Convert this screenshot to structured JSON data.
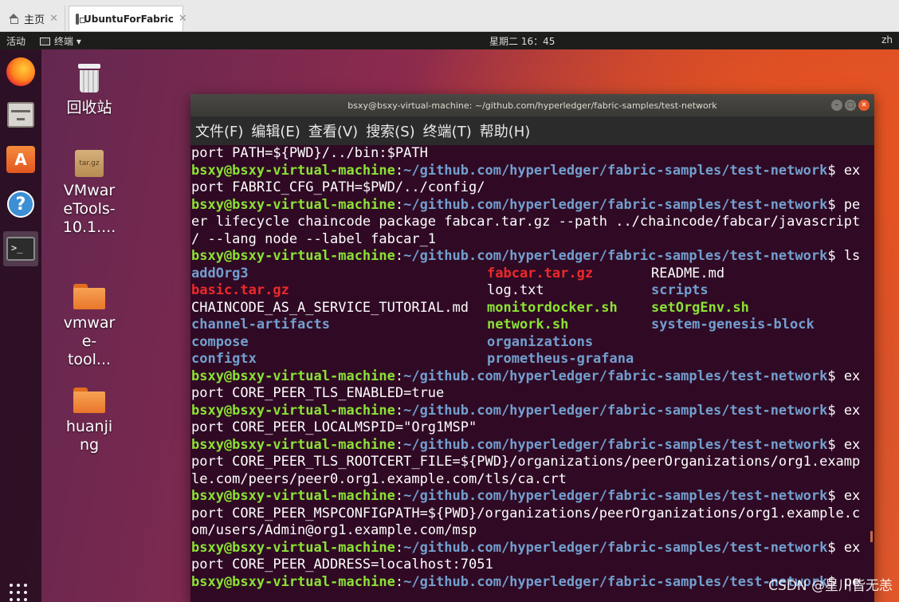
{
  "vm_tabs": [
    {
      "label": "主页",
      "icon": "home-icon"
    },
    {
      "label": "UbuntuForFabric",
      "icon": "vm-icon"
    }
  ],
  "topbar": {
    "activities": "活动",
    "app_menu": "终端 ▾",
    "clock": "星期二 16：45",
    "lang": "zh"
  },
  "desktop_icons": [
    {
      "label": "回收站",
      "icon": "trash-icon"
    },
    {
      "label_lines": [
        "VMwar",
        "eTools-",
        "10.1...."
      ],
      "icon": "archive-icon",
      "badge": "tar.gz"
    },
    {
      "label_lines": [
        "vmwar",
        "e-",
        "tool..."
      ],
      "icon": "folder-icon"
    },
    {
      "label_lines": [
        "huanji",
        "ng"
      ],
      "icon": "folder-icon"
    }
  ],
  "dock": [
    "firefox-icon",
    "files-icon",
    "software-center-icon",
    "help-icon",
    "terminal-icon"
  ],
  "window": {
    "title": "bsxy@bsxy-virtual-machine: ~/github.com/hyperledger/fabric-samples/test-network",
    "menus": [
      "文件(F)",
      "编辑(E)",
      "查看(V)",
      "搜索(S)",
      "终端(T)",
      "帮助(H)"
    ]
  },
  "terminal": {
    "user": "bsxy@bsxy-virtual-machine",
    "path": "~/github.com/hyperledger/fabric-samples/test-network",
    "lines": [
      {
        "type": "text",
        "text": "port PATH=${PWD}/../bin:$PATH"
      },
      {
        "type": "prompt",
        "cmd": "ex"
      },
      {
        "type": "text",
        "text": "port FABRIC_CFG_PATH=$PWD/../config/"
      },
      {
        "type": "prompt",
        "cmd": "pe"
      },
      {
        "type": "text",
        "text": "er lifecycle chaincode package fabcar.tar.gz --path ../chaincode/fabcar/javascript"
      },
      {
        "type": "text",
        "text": "/ --lang node --label fabcar_1"
      },
      {
        "type": "prompt",
        "cmd": "ls"
      }
    ],
    "ls_rows": [
      [
        {
          "t": "addOrg3",
          "c": "blue"
        },
        {
          "t": "fabcar.tar.gz",
          "c": "red"
        },
        {
          "t": "README.md",
          "c": "white"
        }
      ],
      [
        {
          "t": "basic.tar.gz",
          "c": "red"
        },
        {
          "t": "log.txt",
          "c": "white"
        },
        {
          "t": "scripts",
          "c": "blue"
        }
      ],
      [
        {
          "t": "CHAINCODE_AS_A_SERVICE_TUTORIAL.md",
          "c": "white"
        },
        {
          "t": "monitordocker.sh",
          "c": "green"
        },
        {
          "t": "setOrgEnv.sh",
          "c": "green"
        }
      ],
      [
        {
          "t": "channel-artifacts",
          "c": "blue"
        },
        {
          "t": "network.sh",
          "c": "green"
        },
        {
          "t": "system-genesis-block",
          "c": "blue"
        }
      ],
      [
        {
          "t": "compose",
          "c": "blue"
        },
        {
          "t": "organizations",
          "c": "blue"
        },
        {
          "t": "",
          "c": "white"
        }
      ],
      [
        {
          "t": "configtx",
          "c": "blue"
        },
        {
          "t": "prometheus-grafana",
          "c": "blue"
        },
        {
          "t": "",
          "c": "white"
        }
      ]
    ],
    "lines_after": [
      {
        "type": "prompt",
        "cmd": "ex"
      },
      {
        "type": "text",
        "text": "port CORE_PEER_TLS_ENABLED=true"
      },
      {
        "type": "prompt",
        "cmd": "ex"
      },
      {
        "type": "text",
        "text": "port CORE_PEER_LOCALMSPID=\"Org1MSP\""
      },
      {
        "type": "prompt",
        "cmd": "ex"
      },
      {
        "type": "text",
        "text": "port CORE_PEER_TLS_ROOTCERT_FILE=${PWD}/organizations/peerOrganizations/org1.examp"
      },
      {
        "type": "text",
        "text": "le.com/peers/peer0.org1.example.com/tls/ca.crt"
      },
      {
        "type": "prompt",
        "cmd": "ex"
      },
      {
        "type": "text",
        "text": "port CORE_PEER_MSPCONFIGPATH=${PWD}/organizations/peerOrganizations/org1.example.c"
      },
      {
        "type": "text",
        "text": "om/users/Admin@org1.example.com/msp"
      },
      {
        "type": "prompt",
        "cmd": "ex"
      },
      {
        "type": "text",
        "text": "port CORE_PEER_ADDRESS=localhost:7051"
      },
      {
        "type": "prompt",
        "cmd": "pe"
      }
    ]
  },
  "watermark": "CSDN @星川皆无恙"
}
